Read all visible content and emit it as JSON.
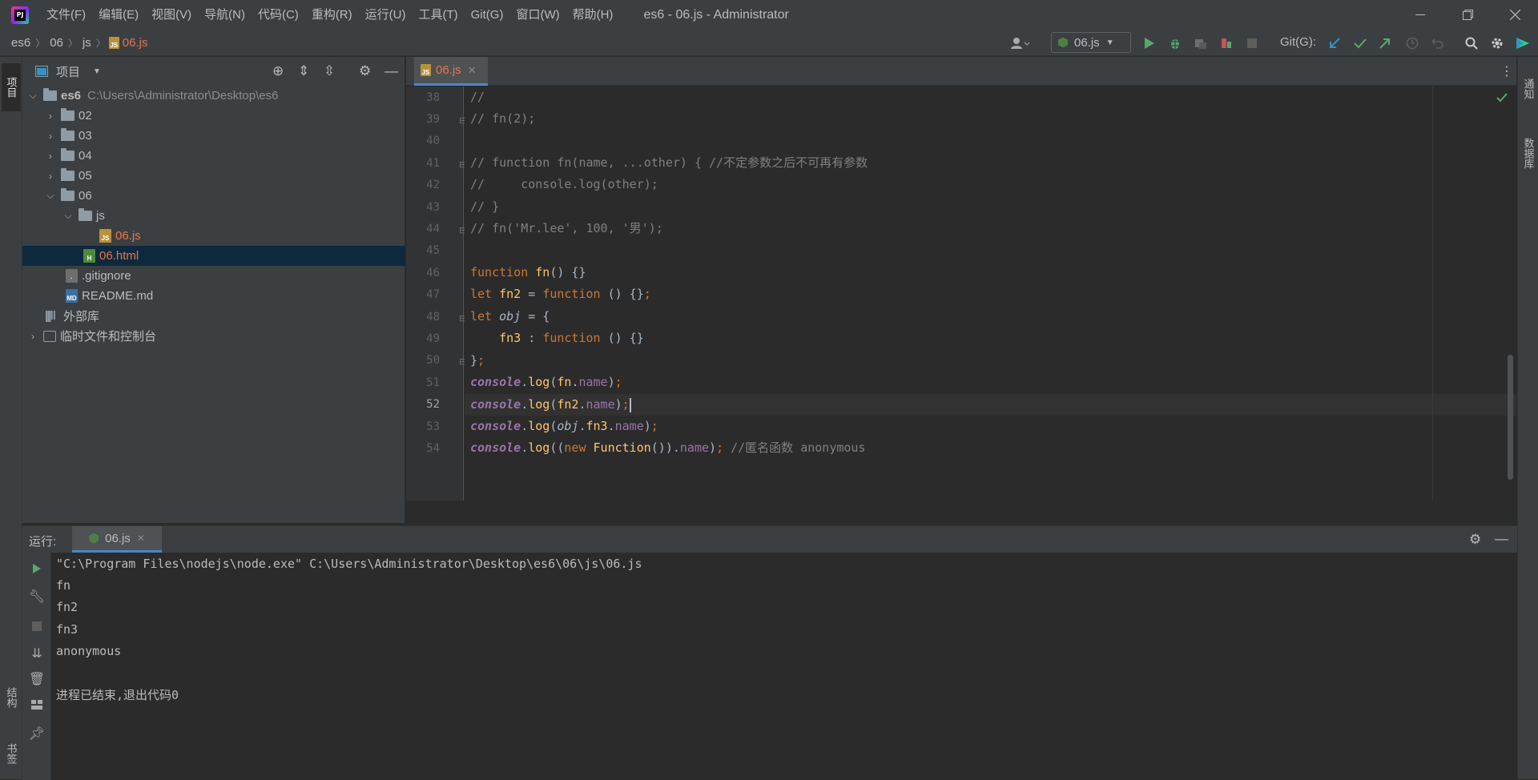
{
  "titlebar": {
    "menu": [
      "文件(F)",
      "编辑(E)",
      "视图(V)",
      "导航(N)",
      "代码(C)",
      "重构(R)",
      "运行(U)",
      "工具(T)",
      "Git(G)",
      "窗口(W)",
      "帮助(H)"
    ],
    "title": "es6 - 06.js - Administrator"
  },
  "breadcrumb": [
    "es6",
    "06",
    "js",
    "06.js"
  ],
  "toolbar": {
    "run_config": "06.js",
    "git_label": "Git(G):"
  },
  "project_panel": {
    "title": "项目",
    "tree": [
      {
        "label": "es6",
        "path": "C:\\Users\\Administrator\\Desktop\\es6"
      },
      {
        "label": "02"
      },
      {
        "label": "03"
      },
      {
        "label": "04"
      },
      {
        "label": "05"
      },
      {
        "label": "06"
      },
      {
        "label": "js"
      },
      {
        "label": "06.js"
      },
      {
        "label": "06.html"
      },
      {
        "label": ".gitignore"
      },
      {
        "label": "README.md"
      },
      {
        "label": "外部库"
      },
      {
        "label": "临时文件和控制台"
      }
    ]
  },
  "left_stripe": {
    "project_tab": "项目",
    "structure_tab": "结构",
    "bookmarks_tab": "书签"
  },
  "right_stripe": {
    "notifications_tab": "通知",
    "database_tab": "数据库"
  },
  "editor": {
    "tab": "06.js",
    "lines": [
      {
        "n": "38",
        "t": "//"
      },
      {
        "n": "39",
        "t": "// fn(2);"
      },
      {
        "n": "40",
        "t": ""
      },
      {
        "n": "41",
        "t": "// function fn(name, ...other) { //不定参数之后不可再有参数"
      },
      {
        "n": "42",
        "t": "//     console.log(other);"
      },
      {
        "n": "43",
        "t": "// }"
      },
      {
        "n": "44",
        "t": "// fn('Mr.lee', 100, '男');"
      },
      {
        "n": "45",
        "t": ""
      },
      {
        "n": "46",
        "t": "function fn() {}"
      },
      {
        "n": "47",
        "t": "let fn2 = function () {};"
      },
      {
        "n": "48",
        "t": "let obj = {"
      },
      {
        "n": "49",
        "t": "    fn3 : function () {}"
      },
      {
        "n": "50",
        "t": "};"
      },
      {
        "n": "51",
        "t": "console.log(fn.name);"
      },
      {
        "n": "52",
        "t": "console.log(fn2.name);"
      },
      {
        "n": "53",
        "t": "console.log(obj.fn3.name);"
      },
      {
        "n": "54",
        "t": "console.log((new Function()).name); //匿名函数 anonymous"
      }
    ]
  },
  "run_panel": {
    "label": "运行:",
    "tab": "06.js",
    "output": [
      "\"C:\\Program Files\\nodejs\\node.exe\" C:\\Users\\Administrator\\Desktop\\es6\\06\\js\\06.js",
      "fn",
      "fn2",
      "fn3",
      "anonymous",
      "",
      "进程已结束,退出代码0"
    ]
  },
  "colors": {
    "accent": "#4a88c7",
    "active_file": "#e8754a",
    "run_green": "#59a869",
    "selection": "#0d293e"
  }
}
